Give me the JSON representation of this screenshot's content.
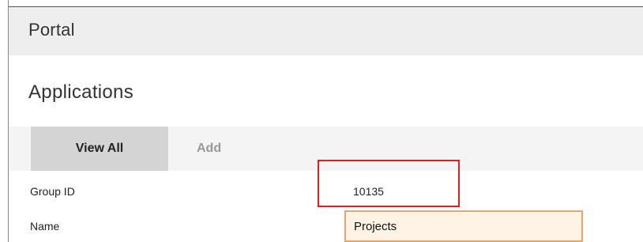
{
  "header": {
    "portal_title": "Portal"
  },
  "section": {
    "title": "Applications"
  },
  "tabs": [
    {
      "label": "View All",
      "active": true
    },
    {
      "label": "Add",
      "active": false
    }
  ],
  "form": {
    "group_id": {
      "label": "Group ID",
      "value": "10135"
    },
    "name": {
      "label": "Name",
      "value": "Projects"
    }
  },
  "colors": {
    "highlight_box": "#e02020",
    "input_border": "#e3a66b",
    "active_tab_bg": "#d4d4d4"
  }
}
